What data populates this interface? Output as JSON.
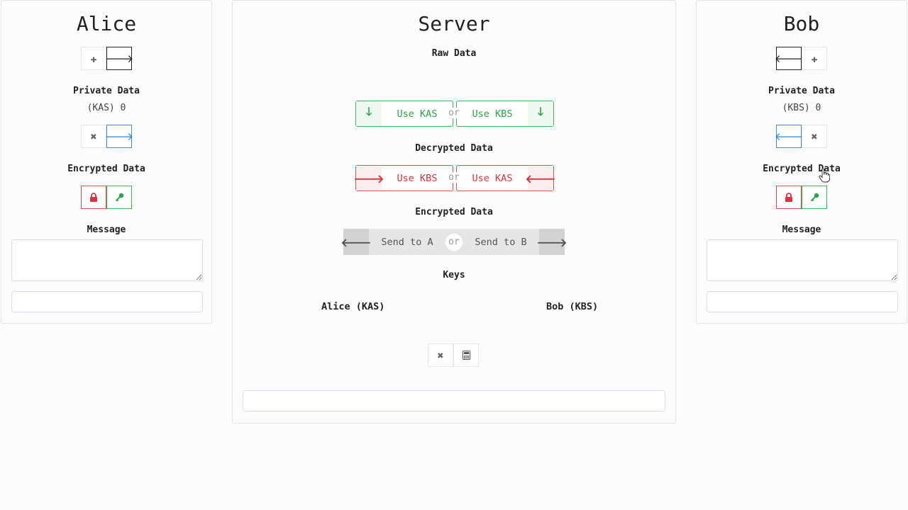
{
  "alice": {
    "title": "Alice",
    "private_label": "Private Data",
    "private_value": "(KAS) 0",
    "encrypted_label": "Encrypted Data",
    "message_label": "Message",
    "message_value": ""
  },
  "server": {
    "title": "Server",
    "raw_label": "Raw Data",
    "use_kas": "Use KAS",
    "use_kbs": "Use KBS",
    "or": "or",
    "decrypted_label": "Decrypted Data",
    "encrypted_label": "Encrypted Data",
    "send_to_a": "Send to A",
    "send_to_b": "Send to B",
    "keys_label": "Keys",
    "alice_key": "Alice (KAS)",
    "bob_key": "Bob (KBS)"
  },
  "bob": {
    "title": "Bob",
    "private_label": "Private Data",
    "private_value": "(KBS) 0",
    "encrypted_label": "Encrypted Data",
    "message_label": "Message",
    "message_value": ""
  },
  "icons": {
    "plus": "plus-icon",
    "arrow_right": "arrow-right-icon",
    "arrow_left": "arrow-left-icon",
    "arrow_down": "arrow-down-icon",
    "close": "close-icon",
    "lock": "lock-icon",
    "key": "key-icon",
    "calculator": "calculator-icon"
  },
  "colors": {
    "green": "#28a745",
    "red": "#d9333f",
    "blue": "#2e86d1"
  }
}
